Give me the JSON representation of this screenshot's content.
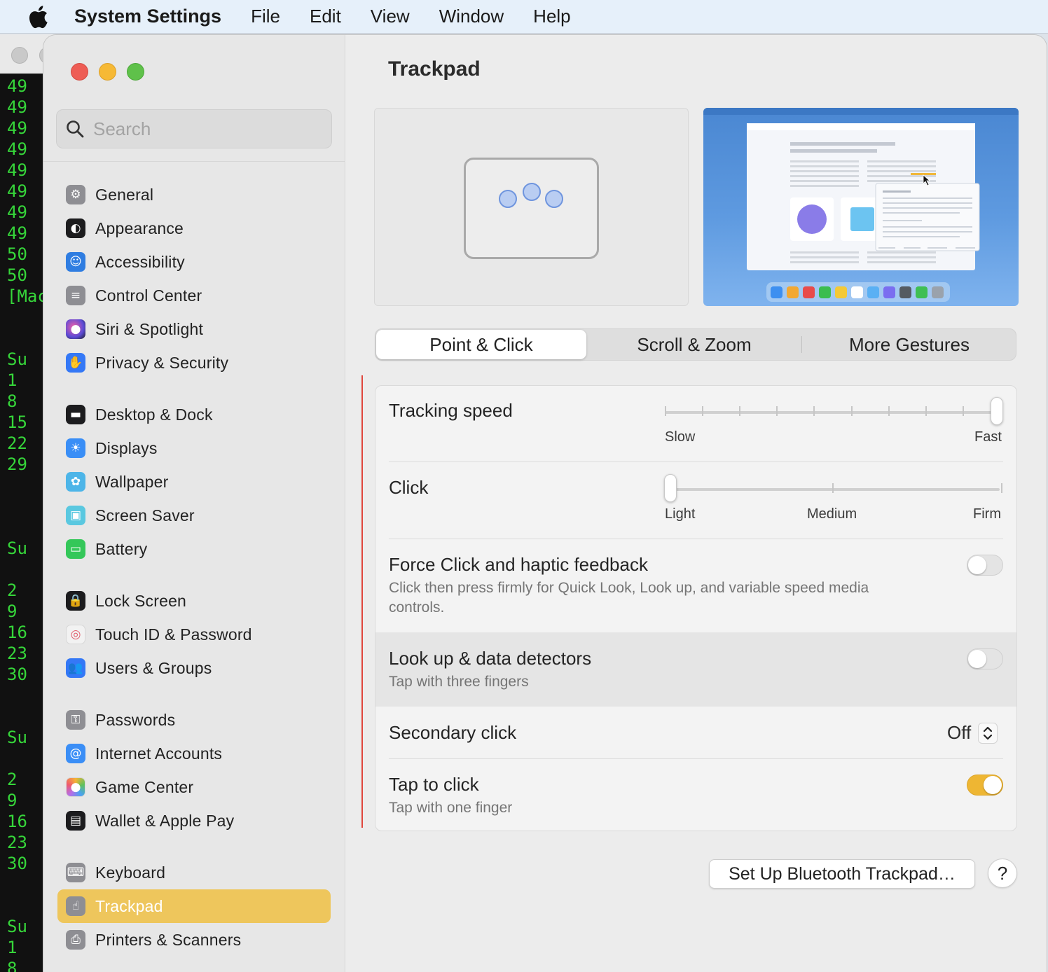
{
  "menubar": {
    "app_name": "System Settings",
    "items": [
      "File",
      "Edit",
      "View",
      "Window",
      "Help"
    ]
  },
  "terminal": {
    "lines": [
      "49",
      "49",
      "49",
      "49",
      "49",
      "49",
      "49",
      "49",
      "50",
      "50",
      "[Mac",
      "Su",
      "1",
      "8",
      "15",
      "22",
      "29",
      "Su",
      "2",
      "9",
      "16",
      "23",
      "30",
      "Su",
      "2",
      "9",
      "16",
      "23",
      "30",
      "Su",
      "1",
      "8"
    ]
  },
  "sidebar": {
    "search_placeholder": "Search",
    "items": [
      {
        "label": "General",
        "icon": "gear-icon",
        "color": "#8e8e93"
      },
      {
        "label": "Appearance",
        "icon": "appearance-icon",
        "color": "#1c1c1e"
      },
      {
        "label": "Accessibility",
        "icon": "accessibility-icon",
        "color": "#2f7de1"
      },
      {
        "label": "Control Center",
        "icon": "control-center-icon",
        "color": "#8e8e93"
      },
      {
        "label": "Siri & Spotlight",
        "icon": "siri-icon",
        "color": "#6a3fc1"
      },
      {
        "label": "Privacy & Security",
        "icon": "hand-icon",
        "color": "#3478f6"
      },
      {
        "label": "Desktop & Dock",
        "icon": "dock-icon",
        "color": "#1c1c1e"
      },
      {
        "label": "Displays",
        "icon": "sun-icon",
        "color": "#3a8ef6"
      },
      {
        "label": "Wallpaper",
        "icon": "flower-icon",
        "color": "#4db5e8"
      },
      {
        "label": "Screen Saver",
        "icon": "screen-saver-icon",
        "color": "#5ac8e0"
      },
      {
        "label": "Battery",
        "icon": "battery-icon",
        "color": "#34c759"
      },
      {
        "label": "Lock Screen",
        "icon": "lock-icon",
        "color": "#1c1c1e"
      },
      {
        "label": "Touch ID & Password",
        "icon": "fingerprint-icon",
        "color": "#f2f2f2"
      },
      {
        "label": "Users & Groups",
        "icon": "users-icon",
        "color": "#3478f6"
      },
      {
        "label": "Passwords",
        "icon": "key-icon",
        "color": "#8e8e93"
      },
      {
        "label": "Internet Accounts",
        "icon": "at-icon",
        "color": "#3a8ef6"
      },
      {
        "label": "Game Center",
        "icon": "game-center-icon",
        "color": "#ffffff"
      },
      {
        "label": "Wallet & Apple Pay",
        "icon": "wallet-icon",
        "color": "#1c1c1e"
      },
      {
        "label": "Keyboard",
        "icon": "keyboard-icon",
        "color": "#8e8e93"
      },
      {
        "label": "Trackpad",
        "icon": "trackpad-icon",
        "color": "#8e8e93",
        "selected": true
      },
      {
        "label": "Printers & Scanners",
        "icon": "printer-icon",
        "color": "#8e8e93"
      }
    ]
  },
  "content": {
    "title": "Trackpad",
    "tabs": [
      "Point & Click",
      "Scroll & Zoom",
      "More Gestures"
    ],
    "active_tab": "Point & Click",
    "tracking_speed": {
      "label": "Tracking speed",
      "min_label": "Slow",
      "max_label": "Fast",
      "value": 1.0,
      "ticks": 10
    },
    "click": {
      "label": "Click",
      "labels": [
        "Light",
        "Medium",
        "Firm"
      ],
      "value": "Light"
    },
    "force_click": {
      "label": "Force Click and haptic feedback",
      "desc": "Click then press firmly for Quick Look, Look up, and variable speed media controls.",
      "on": false
    },
    "lookup": {
      "label": "Look up & data detectors",
      "desc": "Tap with three fingers",
      "on": false
    },
    "secondary_click": {
      "label": "Secondary click",
      "value": "Off"
    },
    "tap_to_click": {
      "label": "Tap to click",
      "desc": "Tap with one finger",
      "on": true
    },
    "setup_button": "Set Up Bluetooth Trackpad…",
    "help_button": "?"
  },
  "colors": {
    "accent": "#eec65c",
    "toggle_on": "#eeb633"
  }
}
